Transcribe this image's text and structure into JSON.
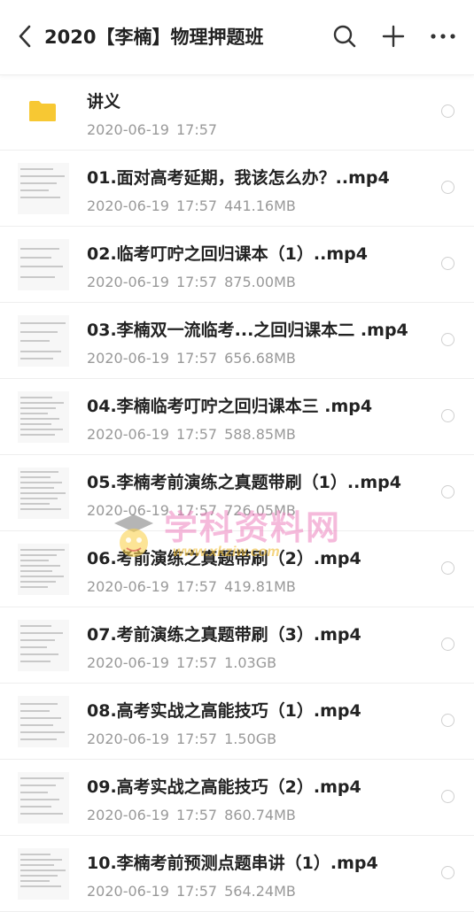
{
  "header": {
    "title": "2020【李楠】物理押题班",
    "back_icon": "back-arrow-icon",
    "search_icon": "search-icon",
    "add_icon": "plus-icon",
    "more_icon": "more-icon"
  },
  "files": [
    {
      "name": "讲义",
      "date": "2020-06-19",
      "time": "17:57",
      "size": "",
      "type": "folder",
      "color": "#F7C833"
    },
    {
      "name": "01.面对高考延期，我该怎么办？..mp4",
      "date": "2020-06-19",
      "time": "17:57",
      "size": "441.16MB",
      "type": "video"
    },
    {
      "name": "02.临考叮咛之回归课本（1）..mp4",
      "date": "2020-06-19",
      "time": "17:57",
      "size": "875.00MB",
      "type": "video"
    },
    {
      "name": "03.李楠双一流临考...之回归课本二 .mp4",
      "date": "2020-06-19",
      "time": "17:57",
      "size": "656.68MB",
      "type": "video"
    },
    {
      "name": "04.李楠临考叮咛之回归课本三 .mp4",
      "date": "2020-06-19",
      "time": "17:57",
      "size": "588.85MB",
      "type": "video"
    },
    {
      "name": "05.李楠考前演练之真题带刷（1）..mp4",
      "date": "2020-06-19",
      "time": "17:57",
      "size": "726.05MB",
      "type": "video"
    },
    {
      "name": "06.考前演练之真题带刷（2）.mp4",
      "date": "2020-06-19",
      "time": "17:57",
      "size": "419.81MB",
      "type": "video"
    },
    {
      "name": "07.考前演练之真题带刷（3）.mp4",
      "date": "2020-06-19",
      "time": "17:57",
      "size": "1.03GB",
      "type": "video"
    },
    {
      "name": "08.高考实战之高能技巧（1）.mp4",
      "date": "2020-06-19",
      "time": "17:57",
      "size": "1.50GB",
      "type": "video"
    },
    {
      "name": "09.高考实战之高能技巧（2）.mp4",
      "date": "2020-06-19",
      "time": "17:57",
      "size": "860.74MB",
      "type": "video"
    },
    {
      "name": "10.李楠考前预测点题串讲（1）.mp4",
      "date": "2020-06-19",
      "time": "17:57",
      "size": "564.24MB",
      "type": "video"
    }
  ],
  "watermark": {
    "text": "学科资料网",
    "url": "www.xkziw.com"
  }
}
